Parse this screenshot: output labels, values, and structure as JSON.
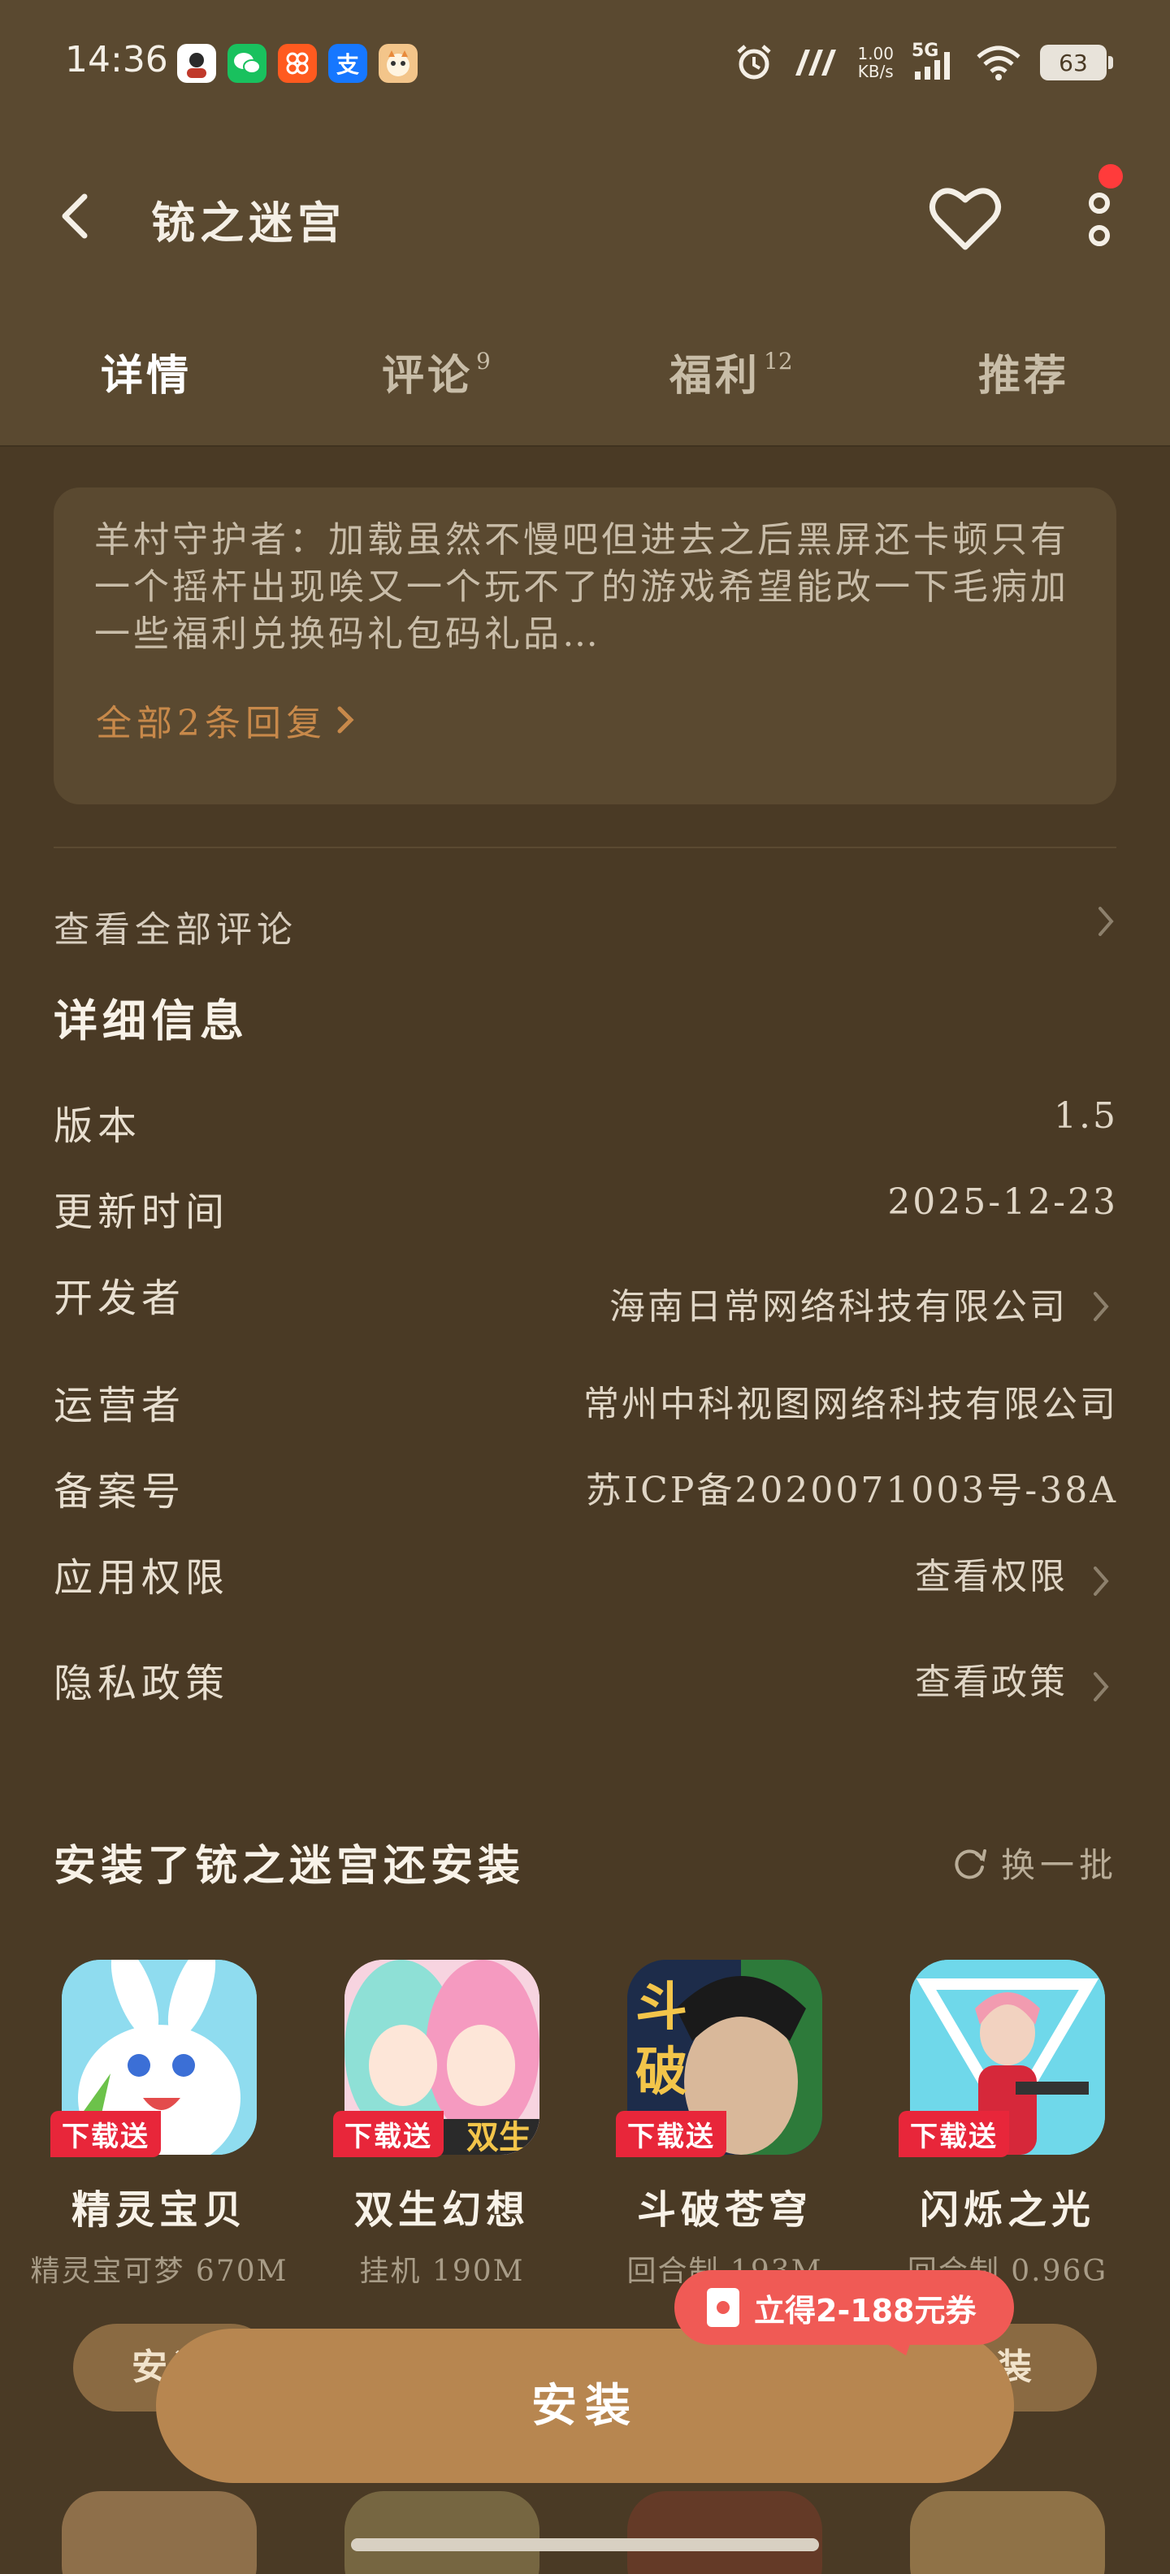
{
  "status_bar": {
    "time": "14:36",
    "net_speed_value": "1.00",
    "net_speed_unit": "KB/s",
    "signal_label": "5G",
    "battery": "63"
  },
  "header": {
    "title": "铳之迷宫"
  },
  "tabs": [
    {
      "label": "详情",
      "count": ""
    },
    {
      "label": "评论",
      "count": "9"
    },
    {
      "label": "福利",
      "count": "12"
    },
    {
      "label": "推荐",
      "count": ""
    }
  ],
  "reply": {
    "text": "羊村守护者：加载虽然不慢吧但进去之后黑屏还卡顿只有一个摇杆出现唉又一个玩不了的游戏希望能改一下毛病加一些福利兑换码礼包码礼品…",
    "more_label": "全部2条回复"
  },
  "see_all_reviews": "查看全部评论",
  "details": {
    "title": "详细信息",
    "rows": [
      {
        "label": "版本",
        "value": "1.5"
      },
      {
        "label": "更新时间",
        "value": "2025-12-23"
      },
      {
        "label": "开发者",
        "value": "海南日常网络科技有限公司"
      },
      {
        "label": "运营者",
        "value": "常州中科视图网络科技有限公司"
      },
      {
        "label": "备案号",
        "value": "苏ICP备2020071003号-38A"
      },
      {
        "label": "应用权限",
        "value": "查看权限"
      },
      {
        "label": "隐私政策",
        "value": "查看政策"
      }
    ]
  },
  "also_installed": {
    "title": "安装了铳之迷宫还安装",
    "refresh_label": "换一批",
    "apps": [
      {
        "name": "精灵宝贝",
        "meta": "精灵宝可梦 670M",
        "badge": "下载送",
        "icon": "white-creature-icon"
      },
      {
        "name": "双生幻想",
        "meta": "挂机 190M",
        "badge": "下载送",
        "icon": "anime-twins-icon"
      },
      {
        "name": "斗破苍穹",
        "meta": "回合制 193M",
        "badge": "下载送",
        "icon": "hero-face-icon"
      },
      {
        "name": "闪烁之光",
        "meta": "回合制 0.96G",
        "badge": "下载送",
        "icon": "red-girl-icon"
      }
    ],
    "install_small": "安装"
  },
  "coupon_label": "立得2-188元券",
  "install_button": "安装",
  "colors": {
    "background": "#4a3a25",
    "accent": "#b78650",
    "coupon": "#f05a55",
    "badge": "#e8263a"
  }
}
